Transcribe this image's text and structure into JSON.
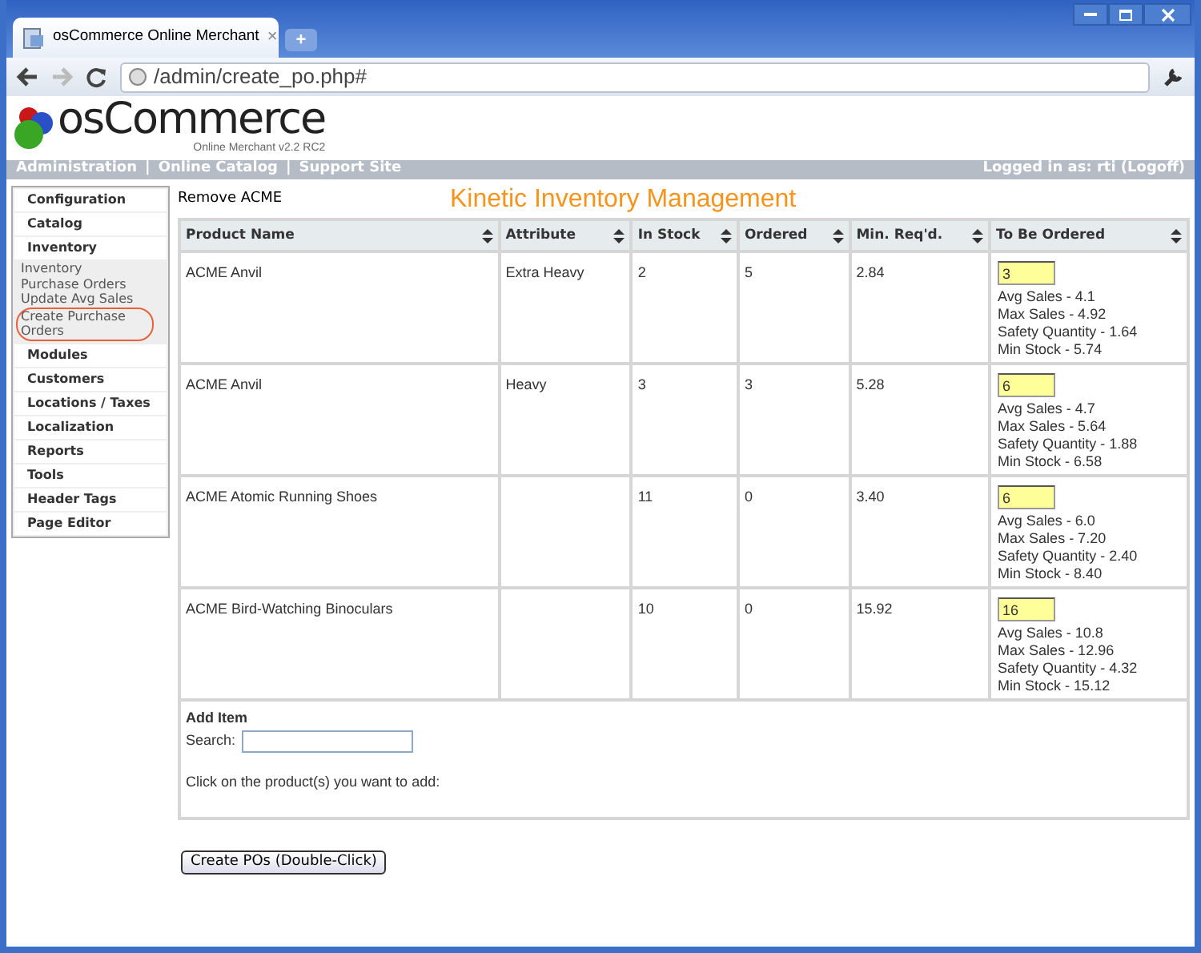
{
  "browser": {
    "tab_title": "osCommerce Online Merchant",
    "tab_close": "×",
    "new_tab": "+",
    "address": "/admin/create_po.php#",
    "window_controls": [
      {
        "kind": "minimize"
      },
      {
        "kind": "maximize"
      },
      {
        "kind": "close"
      }
    ]
  },
  "header": {
    "logo": "osCommerce",
    "tagline": "Online Merchant v2.2 RC2"
  },
  "nav": {
    "links": [
      "Administration",
      "Online Catalog",
      "Support Site"
    ],
    "separator": "|",
    "login": "Logged in as: rti (Logoff)"
  },
  "sidebar": [
    {
      "label": "Configuration"
    },
    {
      "label": "Catalog"
    },
    {
      "label": "Inventory",
      "children": [
        {
          "label": "Inventory",
          "circled": false
        },
        {
          "label": "Purchase Orders",
          "circled": false
        },
        {
          "label": "Update Avg Sales",
          "circled": false
        },
        {
          "label": "Create Purchase Orders",
          "circled": true
        }
      ]
    },
    {
      "label": "Modules"
    },
    {
      "label": "Customers"
    },
    {
      "label": "Locations / Taxes"
    },
    {
      "label": "Localization"
    },
    {
      "label": "Reports"
    },
    {
      "label": "Tools"
    },
    {
      "label": "Header Tags"
    },
    {
      "label": "Page Editor"
    }
  ],
  "remove_link": "Remove ACME",
  "title": "Kinetic Inventory Management",
  "table": {
    "columns": [
      "Product Name",
      "Attribute",
      "In Stock",
      "Ordered",
      "Min. Req'd.",
      "To Be Ordered"
    ],
    "rows": [
      {
        "product": "ACME Anvil",
        "attribute": "Extra Heavy",
        "in_stock": "2",
        "ordered": "5",
        "min_reqd": "2.84",
        "to_order": "3",
        "stats": [
          "Avg Sales - 4.1",
          "Max Sales - 4.92",
          "Safety Quantity - 1.64",
          "Min Stock - 5.74"
        ]
      },
      {
        "product": "ACME Anvil",
        "attribute": "Heavy",
        "in_stock": "3",
        "ordered": "3",
        "min_reqd": "5.28",
        "to_order": "6",
        "stats": [
          "Avg Sales - 4.7",
          "Max Sales - 5.64",
          "Safety Quantity - 1.88",
          "Min Stock - 6.58"
        ]
      },
      {
        "product": "ACME Atomic Running Shoes",
        "in_stock": "11",
        "ordered": "0",
        "min_reqd": "3.40",
        "to_order": "6",
        "stats": [
          "Avg Sales - 6.0",
          "Max Sales - 7.20",
          "Safety Quantity - 2.40",
          "Min Stock - 8.40"
        ]
      },
      {
        "product": "ACME Bird-Watching Binoculars",
        "in_stock": "10",
        "ordered": "0",
        "min_reqd": "15.92",
        "to_order": "16",
        "stats": [
          "Avg Sales - 10.8",
          "Max Sales - 12.96",
          "Safety Quantity - 4.32",
          "Min Stock - 15.12"
        ]
      }
    ]
  },
  "add_item": {
    "heading": "Add Item",
    "search_label": "Search:",
    "hint": "Click on the product(s) you want to add:"
  },
  "button": "Create POs (Double-Click)"
}
